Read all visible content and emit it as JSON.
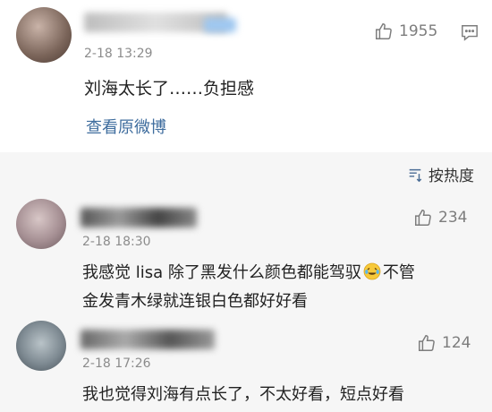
{
  "main_comment": {
    "time": "2-18 13:29",
    "text": "刘海太长了……负担感",
    "likes": "1955",
    "view_original": "查看原微博"
  },
  "sort": {
    "label": "按热度"
  },
  "comments": [
    {
      "time": "2-18 18:30",
      "likes": "234",
      "line1_a": "我感觉 lisa 除了黑发什么颜色都能驾驭",
      "line1_b": "不管",
      "line2": "金发青木绿就连银白色都好好看"
    },
    {
      "time": "2-18 17:26",
      "likes": "124",
      "line1": "我也觉得刘海有点长了，不太好看，短点好看"
    }
  ]
}
